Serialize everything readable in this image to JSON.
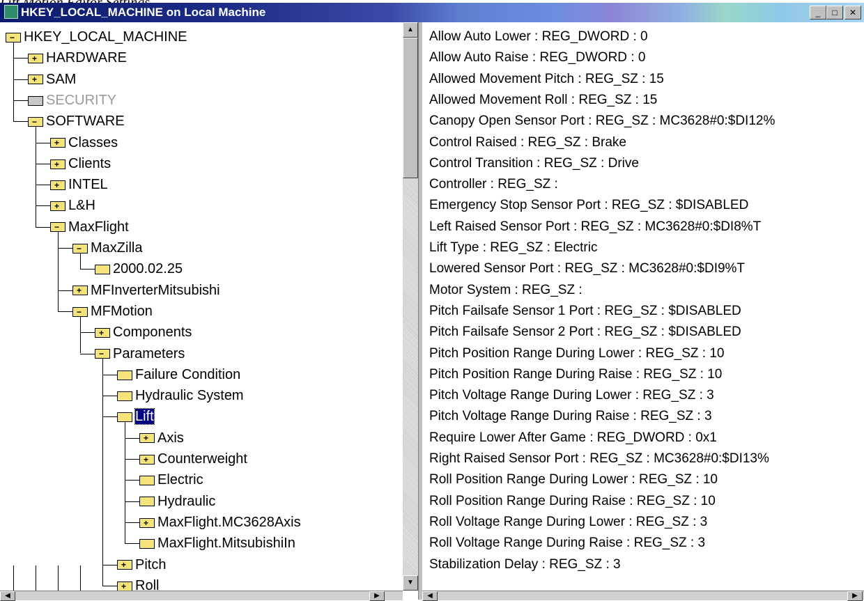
{
  "caption": "Lift Motion Editor Settings",
  "window": {
    "title": "HKEY_LOCAL_MACHINE on Local Machine",
    "buttons": {
      "minimize": "_",
      "maximize": "□",
      "close": "✕"
    }
  },
  "tree": [
    {
      "label": "HKEY_LOCAL_MACHINE",
      "state": "open",
      "depth": 0
    },
    {
      "label": "HARDWARE",
      "state": "plus",
      "depth": 1
    },
    {
      "label": "SAM",
      "state": "plus",
      "depth": 1
    },
    {
      "label": "SECURITY",
      "state": "gray",
      "depth": 1
    },
    {
      "label": "SOFTWARE",
      "state": "open",
      "depth": 1
    },
    {
      "label": "Classes",
      "state": "plus",
      "depth": 2
    },
    {
      "label": "Clients",
      "state": "plus",
      "depth": 2
    },
    {
      "label": "INTEL",
      "state": "plus",
      "depth": 2
    },
    {
      "label": "L&H",
      "state": "plus",
      "depth": 2
    },
    {
      "label": "MaxFlight",
      "state": "open",
      "depth": 2
    },
    {
      "label": "MaxZilla",
      "state": "open",
      "depth": 3
    },
    {
      "label": "2000.02.25",
      "state": "leaf",
      "depth": 4
    },
    {
      "label": "MFInverterMitsubishi",
      "state": "plus",
      "depth": 3
    },
    {
      "label": "MFMotion",
      "state": "open",
      "depth": 3
    },
    {
      "label": "Components",
      "state": "plus",
      "depth": 4
    },
    {
      "label": "Parameters",
      "state": "open",
      "depth": 4
    },
    {
      "label": "Failure Condition",
      "state": "leaf",
      "depth": 5
    },
    {
      "label": "Hydraulic System",
      "state": "leaf",
      "depth": 5
    },
    {
      "label": "Lift",
      "state": "selected",
      "depth": 5
    },
    {
      "label": "Axis",
      "state": "plus",
      "depth": 6
    },
    {
      "label": "Counterweight",
      "state": "plus",
      "depth": 6
    },
    {
      "label": "Electric",
      "state": "leaf",
      "depth": 6
    },
    {
      "label": "Hydraulic",
      "state": "leaf",
      "depth": 6
    },
    {
      "label": "MaxFlight.MC3628Axis",
      "state": "plus",
      "depth": 6
    },
    {
      "label": "MaxFlight.MitsubishiIn",
      "state": "leaf",
      "depth": 6
    },
    {
      "label": "Pitch",
      "state": "plus",
      "depth": 5
    },
    {
      "label": "Roll",
      "state": "plus",
      "depth": 5
    }
  ],
  "values": [
    "Allow Auto Lower : REG_DWORD : 0",
    "Allow Auto Raise : REG_DWORD : 0",
    "Allowed Movement Pitch : REG_SZ : 15",
    "Allowed Movement Roll : REG_SZ : 15",
    "Canopy Open Sensor Port : REG_SZ : MC3628#0:$DI12%",
    "Control Raised : REG_SZ : Brake",
    "Control Transition : REG_SZ : Drive",
    "Controller : REG_SZ :",
    "Emergency Stop Sensor Port : REG_SZ : $DISABLED",
    "Left Raised Sensor Port : REG_SZ : MC3628#0:$DI8%T",
    "Lift Type : REG_SZ : Electric",
    "Lowered Sensor Port : REG_SZ : MC3628#0:$DI9%T",
    "Motor System : REG_SZ :",
    "Pitch Failsafe Sensor 1 Port : REG_SZ : $DISABLED",
    "Pitch Failsafe Sensor 2 Port : REG_SZ : $DISABLED",
    "Pitch Position Range During Lower : REG_SZ : 10",
    "Pitch Position Range During Raise : REG_SZ : 10",
    "Pitch Voltage Range During Lower : REG_SZ : 3",
    "Pitch Voltage Range During Raise : REG_SZ : 3",
    "Require Lower After Game : REG_DWORD : 0x1",
    "Right Raised Sensor Port : REG_SZ : MC3628#0:$DI13%",
    "Roll Position Range During Lower : REG_SZ : 10",
    "Roll Position Range During Raise : REG_SZ : 10",
    "Roll Voltage Range During Lower : REG_SZ : 3",
    "Roll Voltage Range During Raise : REG_SZ : 3",
    "Stabilization Delay : REG_SZ : 3"
  ],
  "scroll": {
    "up": "▲",
    "down": "▼",
    "left": "◀",
    "right": "▶"
  }
}
